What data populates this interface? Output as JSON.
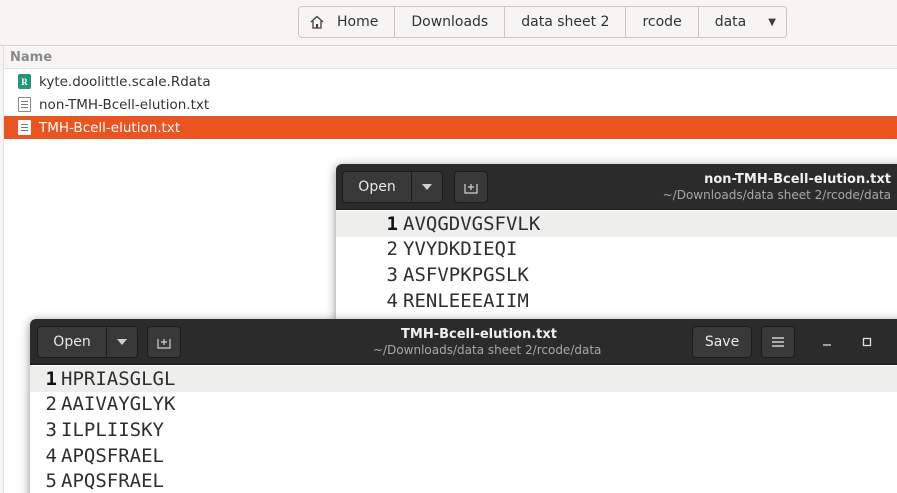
{
  "file_manager": {
    "breadcrumb": [
      "Home",
      "Downloads",
      "data sheet 2",
      "rcode",
      "data"
    ],
    "column_header": "Name",
    "files": [
      {
        "name": "kyte.doolittle.scale.Rdata",
        "icon": "rdata-file-icon",
        "selected": false
      },
      {
        "name": "non-TMH-Bcell-elution.txt",
        "icon": "text-file-icon",
        "selected": false
      },
      {
        "name": "TMH-Bcell-elution.txt",
        "icon": "text-file-icon",
        "selected": true
      }
    ],
    "selection_color": "#e95420"
  },
  "window_back": {
    "open_label": "Open",
    "title": "non-TMH-Bcell-elution.txt",
    "subtitle": "~/Downloads/data sheet 2/rcode/data",
    "lines": [
      {
        "num": "1",
        "text": "AVQGDVGSFVLK"
      },
      {
        "num": "2",
        "text": "YVYDKDIEQI"
      },
      {
        "num": "3",
        "text": "ASFVPKPGSLK"
      },
      {
        "num": "4",
        "text": "RENLEEEAIIM"
      }
    ]
  },
  "window_front": {
    "open_label": "Open",
    "title": "TMH-Bcell-elution.txt",
    "subtitle": "~/Downloads/data sheet 2/rcode/data",
    "save_label": "Save",
    "lines": [
      {
        "num": "1",
        "text": "HPRIASGLGL"
      },
      {
        "num": "2",
        "text": "AAIVAYGLYK"
      },
      {
        "num": "3",
        "text": "ILPLIISKY"
      },
      {
        "num": "4",
        "text": "APQSFRAEL"
      },
      {
        "num": "5",
        "text": "APQSFRAEL"
      }
    ]
  },
  "header_bar_color": "#2b2b2b"
}
